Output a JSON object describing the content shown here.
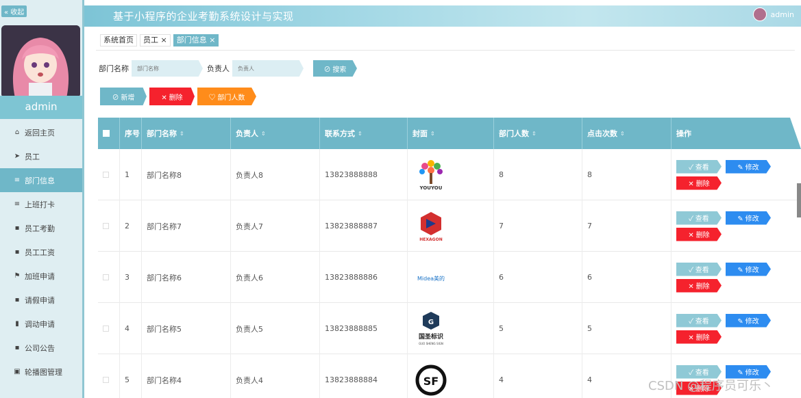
{
  "sidebar": {
    "collapse_label": "« 收起",
    "username": "admin",
    "items": [
      {
        "label": "返回主页",
        "icon": "home-icon",
        "glyph": "⌂"
      },
      {
        "label": "员工",
        "icon": "send-icon",
        "glyph": "➤"
      },
      {
        "label": "部门信息",
        "icon": "list-icon",
        "glyph": "≡"
      },
      {
        "label": "上班打卡",
        "icon": "list-icon",
        "glyph": "≡"
      },
      {
        "label": "员工考勤",
        "icon": "grid-icon",
        "glyph": "▪"
      },
      {
        "label": "员工工资",
        "icon": "grid-icon",
        "glyph": "▪"
      },
      {
        "label": "加班申请",
        "icon": "flag-icon",
        "glyph": "⚑"
      },
      {
        "label": "请假申请",
        "icon": "grid-icon",
        "glyph": "▪"
      },
      {
        "label": "调动申请",
        "icon": "bar-chart-icon",
        "glyph": "▮"
      },
      {
        "label": "公司公告",
        "icon": "grid-icon",
        "glyph": "▪"
      },
      {
        "label": "轮播图管理",
        "icon": "image-icon",
        "glyph": "▣"
      }
    ]
  },
  "header": {
    "title": "基于小程序的企业考勤系统设计与实现",
    "user": "admin"
  },
  "tabs": [
    {
      "label": "系统首页"
    },
    {
      "label": "员工 ×"
    },
    {
      "label": "部门信息 ×"
    }
  ],
  "search": {
    "dept_label": "部门名称",
    "dept_placeholder": "部门名称",
    "head_label": "负责人",
    "head_placeholder": "负责人",
    "button": "⊘ 搜索"
  },
  "actions": {
    "add": "⊘ 新增",
    "delete": "✕ 删除",
    "stat": "♡ 部门人数"
  },
  "table": {
    "headers": [
      "序号",
      "部门名称",
      "负责人",
      "联系方式",
      "封面",
      "部门人数",
      "点击次数",
      "操作"
    ],
    "sort_glyph": "⇕",
    "view_label": "✓ 查看",
    "edit_label": "✎ 修改",
    "delete_label": "✕ 删除",
    "rows": [
      {
        "no": "1",
        "name": "部门名称8",
        "head": "负责人8",
        "phone": "13823888888",
        "count": "8",
        "clicks": "8",
        "cover": "youyou-logo"
      },
      {
        "no": "2",
        "name": "部门名称7",
        "head": "负责人7",
        "phone": "13823888887",
        "count": "7",
        "clicks": "7",
        "cover": "hexagon-logo"
      },
      {
        "no": "3",
        "name": "部门名称6",
        "head": "负责人6",
        "phone": "13823888886",
        "count": "6",
        "clicks": "6",
        "cover": "midea-logo"
      },
      {
        "no": "4",
        "name": "部门名称5",
        "head": "负责人5",
        "phone": "13823888885",
        "count": "5",
        "clicks": "5",
        "cover": "guosheng-logo"
      },
      {
        "no": "5",
        "name": "部门名称4",
        "head": "负责人4",
        "phone": "13823888884",
        "count": "4",
        "clicks": "4",
        "cover": "sf-logo"
      }
    ]
  },
  "logos": {
    "youyou": "YOUYOU",
    "hexagon": "HEXAGON",
    "midea": "Midea美的",
    "guosheng": "国圣标识",
    "guosheng_small": "GUO SHENG SIGN",
    "sf": "SF"
  },
  "watermark": "CSDN @程序员可乐丶",
  "colors": {
    "accent": "#6fb7c8",
    "danger": "#f5222d",
    "warning": "#ff8c1a",
    "primary": "#2d8cf0"
  }
}
